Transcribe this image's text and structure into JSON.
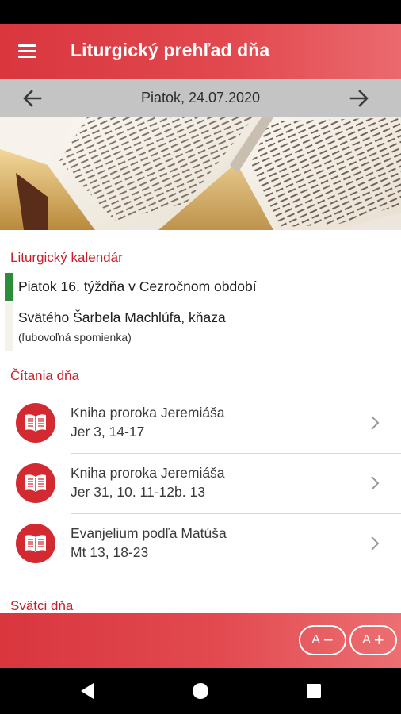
{
  "app_bar": {
    "title": "Liturgický prehľad dňa",
    "menu_icon": "hamburger-menu-icon"
  },
  "date_nav": {
    "date": "Piatok, 24.07.2020",
    "prev_icon": "arrow-left-icon",
    "next_icon": "arrow-right-icon"
  },
  "banner": {
    "image": "open-bible-image"
  },
  "calendar": {
    "section_title": "Liturgický kalendár",
    "entries": [
      {
        "title": "Piatok 16. týždňa v Cezročnom období",
        "color": "#2e8b3a"
      },
      {
        "title": "Svätého Šarbela Machlúfa, kňaza",
        "rank": "(ľubovoľná spomienka)",
        "color": "#f5f2ee"
      }
    ]
  },
  "readings": {
    "section_title": "Čítania dňa",
    "items": [
      {
        "book": "Kniha proroka Jeremiáša",
        "ref": "Jer 3, 14-17"
      },
      {
        "book": "Kniha proroka Jeremiáša",
        "ref": "Jer 31, 10. 11-12b. 13"
      },
      {
        "book": "Evanjelium podľa Matúša",
        "ref": "Mt 13, 18-23"
      }
    ],
    "icon": "open-book-icon",
    "chevron_icon": "chevron-right-icon"
  },
  "saints": {
    "section_title": "Svätci dňa"
  },
  "font_controls": {
    "decrease_label": "A",
    "decrease_symbol": "−",
    "increase_label": "A",
    "increase_symbol": "+"
  },
  "system_nav": {
    "back_icon": "back-triangle-icon",
    "home_icon": "home-circle-icon",
    "recents_icon": "recents-square-icon"
  },
  "colors": {
    "accent": "#d9363e",
    "section_title": "#c8202b",
    "date_bar": "#c4c4c4"
  }
}
